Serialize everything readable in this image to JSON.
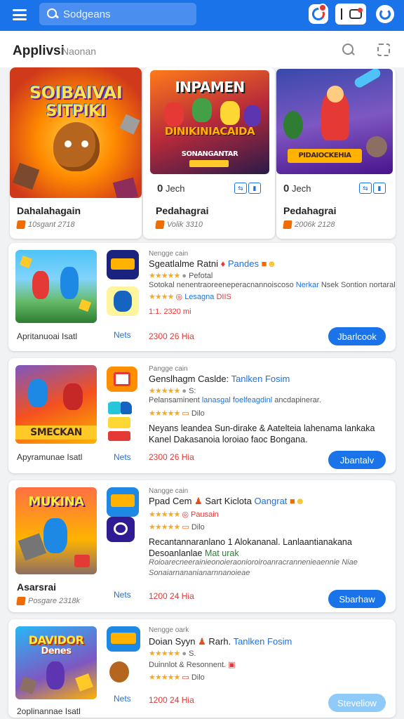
{
  "topbar": {
    "search_placeholder": "Sodgeans"
  },
  "header": {
    "title": "Applivsi",
    "subtitle": "Naonan"
  },
  "featured": [
    {
      "art_title_1": "SOIBAIVAI",
      "art_title_2": "SITPIKI",
      "name": "Dahalahagain",
      "meta": "10sgant 2718"
    },
    {
      "art_title_1": "INPAMEN",
      "art_title_2": "DINIKINIACAIDA",
      "art_caption": "SONANGANTAR",
      "rank": "0",
      "rank_label": "Jech",
      "name": "Pedahagrai",
      "meta": "Volik 3310"
    },
    {
      "art_caption": "PIDAIOCKEHIA",
      "rank": "0",
      "rank_label": "Jech",
      "name": "Pedahagrai",
      "meta": "2006k 2128"
    }
  ],
  "list": [
    {
      "dev": "Nengge cain",
      "title": "Sgeatlalme Ratni",
      "title_hl": "Pandes",
      "line1": "Pefotal",
      "line2": "Sotokal nenentraoreeneperacnannoiscoso",
      "line2_hl": "Nerkar",
      "line2_tail": "Nsek Sontion nortaral",
      "line3": "Lesagna",
      "line3_hl": "DIIS",
      "line4": "1:1. 2320 mi",
      "size": "Apritanuoai Isatl",
      "nets": "Nets",
      "price": "2300 26",
      "price_tail": "Hia",
      "button": "Jbarlcook"
    },
    {
      "dev": "Pangge cain",
      "title": "Genslhagm Caslde:",
      "title_hl": "Tanlken Fosim",
      "line1": "Pelansaminent",
      "line2": "Pelansaminent",
      "line2_hl": "lanasgal foelfeagdinl",
      "line2_tail": "ancdapinerar.",
      "line3": "Dilo",
      "line4": "",
      "desc": "Neyans leandea Sun-dirake & Aatelteia lahenama lankaka Kanel Dakasanoia loroiao faoc Bongana.",
      "art": "SMECKAN",
      "size": "Apyramunae Isatl",
      "nets": "Nets",
      "price": "2300 26",
      "price_tail": "Hia",
      "button": "Jbantalv"
    },
    {
      "dev": "Nangge cain",
      "title": "Ppad Cem",
      "title_mid": "Sart Kiclota",
      "title_hl": "Oangrat",
      "line1": "Pausain",
      "line3": "Dilo",
      "desc": "Recantannaranlano 1 Alokananal. Lanlaantianakana Desoanlanlae",
      "desc_hl": "Mat urak",
      "desc2": "Roioarecneerainieonoieraonioroiroanracrannenieaennie Niae Sonaiarnananianarnnanoieae",
      "art": "MUKINA",
      "name": "Asarsrai",
      "meta": "Posgare 2318k",
      "nets": "Nets",
      "price": "1200 24",
      "price_tail": "Hia",
      "button": "Sbarhaw"
    },
    {
      "dev": "Nengge oark",
      "title": "Doian Syyn",
      "title_mid": "Rarh.",
      "title_hl": "Tanlken Fosim",
      "line1": "Duinnlot & Resonnent.",
      "line1_tail": "S.",
      "line3": "Dilo",
      "art_title_1": "DAVIDOR",
      "art_title_2": "Denes",
      "size": "2oplinannae Isatl",
      "nets": "Nets",
      "price": "1200 24",
      "price_tail": "Hia",
      "button": "Steveliow"
    }
  ],
  "colors": {
    "primary": "#1a73e8",
    "star": "#f9a825",
    "price": "#e53935"
  }
}
